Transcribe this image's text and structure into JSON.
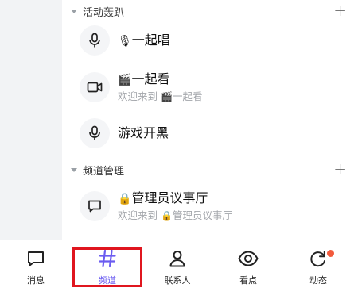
{
  "sections": [
    {
      "title": "活动轰趴",
      "channels": [
        {
          "icon": "microphone-icon",
          "emoji": "🎙",
          "name": "一起唱",
          "subtitle": null
        },
        {
          "icon": "video-camera-icon",
          "emoji": "🎬",
          "name": "一起看",
          "subtitle": {
            "prefix": "欢迎来到 ",
            "emoji": "🎬",
            "name": "一起看"
          }
        },
        {
          "icon": "microphone-icon",
          "emoji": "",
          "name": "游戏开黑",
          "subtitle": null
        }
      ]
    },
    {
      "title": "频道管理",
      "channels": [
        {
          "icon": "chat-bubble-icon",
          "emoji": "🔒",
          "name": "管理员议事厅",
          "subtitle": {
            "prefix": "欢迎来到 ",
            "emoji": "🔒",
            "name": "管理员议事厅"
          }
        }
      ]
    }
  ],
  "tabbar": {
    "active": "频道",
    "highlight_color": "#e0161f",
    "accent_color": "#6b5cf0",
    "tabs": [
      {
        "label": "消息",
        "icon": "message-icon"
      },
      {
        "label": "频道",
        "icon": "hash-icon"
      },
      {
        "label": "联系人",
        "icon": "person-icon"
      },
      {
        "label": "看点",
        "icon": "eye-icon"
      },
      {
        "label": "动态",
        "icon": "refresh-icon",
        "has_badge": true
      }
    ]
  }
}
